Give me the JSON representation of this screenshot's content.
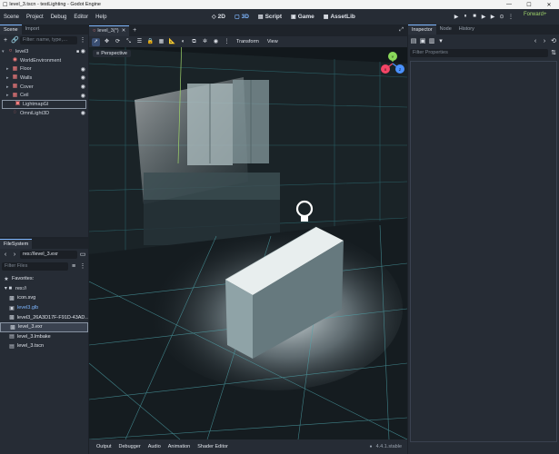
{
  "window": {
    "title": "level_3.tscn - testLighting - Godot Engine",
    "controls": [
      "—",
      "☐",
      "✕"
    ]
  },
  "menu": [
    "Scene",
    "Project",
    "Debug",
    "Editor",
    "Help"
  ],
  "workspaces": [
    {
      "label": "2D",
      "icon": "◇",
      "active": false
    },
    {
      "label": "3D",
      "icon": "▢",
      "active": true
    },
    {
      "label": "Script",
      "icon": "▤",
      "active": false
    },
    {
      "label": "Game",
      "icon": "▣",
      "active": false
    },
    {
      "label": "AssetLib",
      "icon": "▦",
      "active": false
    }
  ],
  "play_controls": [
    "▶",
    "⏸",
    "■",
    "▶",
    "▶",
    "⊙",
    "⋮"
  ],
  "renderer": "Forward+",
  "scene_dock": {
    "tabs": [
      "Scene",
      "Import"
    ],
    "filter_placeholder": "Filter: name, type,…",
    "nodes": [
      {
        "name": "level3",
        "icon": "○",
        "color": "#fc7f7f",
        "indent": 0,
        "arrow": "▾",
        "visible": true,
        "camera": true
      },
      {
        "name": "WorldEnvironment",
        "icon": "◉",
        "color": "#fc7f7f",
        "indent": 1,
        "arrow": "",
        "visible": false,
        "camera": false
      },
      {
        "name": "Floor",
        "icon": "▦",
        "color": "#fc7f7f",
        "indent": 1,
        "arrow": "▸",
        "visible": true,
        "camera": false
      },
      {
        "name": "Walls",
        "icon": "▦",
        "color": "#fc7f7f",
        "indent": 1,
        "arrow": "▸",
        "visible": true,
        "camera": false
      },
      {
        "name": "Cover",
        "icon": "▦",
        "color": "#fc7f7f",
        "indent": 1,
        "arrow": "▸",
        "visible": true,
        "camera": false
      },
      {
        "name": "Ceil",
        "icon": "▦",
        "color": "#fc7f7f",
        "indent": 1,
        "arrow": "▸",
        "visible": true,
        "camera": false
      },
      {
        "name": "LightmapGI",
        "icon": "▣",
        "color": "#fc7f7f",
        "indent": 1,
        "arrow": "",
        "visible": false,
        "camera": false
      },
      {
        "name": "OmniLight3D",
        "icon": "◌",
        "color": "#fc7f7f",
        "indent": 1,
        "arrow": "",
        "visible": true,
        "camera": false
      }
    ]
  },
  "filesystem_dock": {
    "tab": "FileSystem",
    "path": "res://level_3.exr",
    "filter_placeholder": "Filter Files",
    "items": [
      {
        "name": "Favorites:",
        "icon": "★",
        "color": "#dfe3ea",
        "indent": 0
      },
      {
        "name": "res://",
        "icon": "▾ ■",
        "color": "#dfe3ea",
        "indent": 0
      },
      {
        "name": "icon.svg",
        "icon": "▩",
        "color": "#dfe3ea",
        "indent": 1
      },
      {
        "name": "level3.glb",
        "icon": "▣",
        "color": "#7fb7ff",
        "indent": 1
      },
      {
        "name": "level3_26A3D17F-F91D-43AD…",
        "icon": "▩",
        "color": "#dfe3ea",
        "indent": 1
      },
      {
        "name": "level_3.exr",
        "icon": "▩",
        "color": "#dfe3ea",
        "indent": 1,
        "selected": true
      },
      {
        "name": "level_3.lmbake",
        "icon": "▤",
        "color": "#dfe3ea",
        "indent": 1
      },
      {
        "name": "level_3.tscn",
        "icon": "▤",
        "color": "#dfe3ea",
        "indent": 1
      }
    ]
  },
  "editor_tabs": [
    {
      "label": "level_3(*)",
      "closable": true
    }
  ],
  "viewport": {
    "perspective_label": "Perspective",
    "menus": [
      "Transform",
      "View"
    ],
    "gizmo_axes": [
      {
        "label": "Y",
        "color": "#8ad85a"
      },
      {
        "label": "X",
        "color": "#f44566"
      },
      {
        "label": "Z",
        "color": "#4a91ff"
      }
    ]
  },
  "inspector_dock": {
    "tabs": [
      "Inspector",
      "Node",
      "History"
    ],
    "filter_placeholder": "Filter Properties"
  },
  "bottom_panel": {
    "tabs": [
      "Output",
      "Debugger",
      "Audio",
      "Animation",
      "Shader Editor"
    ],
    "version": "4.4.1.stable"
  }
}
